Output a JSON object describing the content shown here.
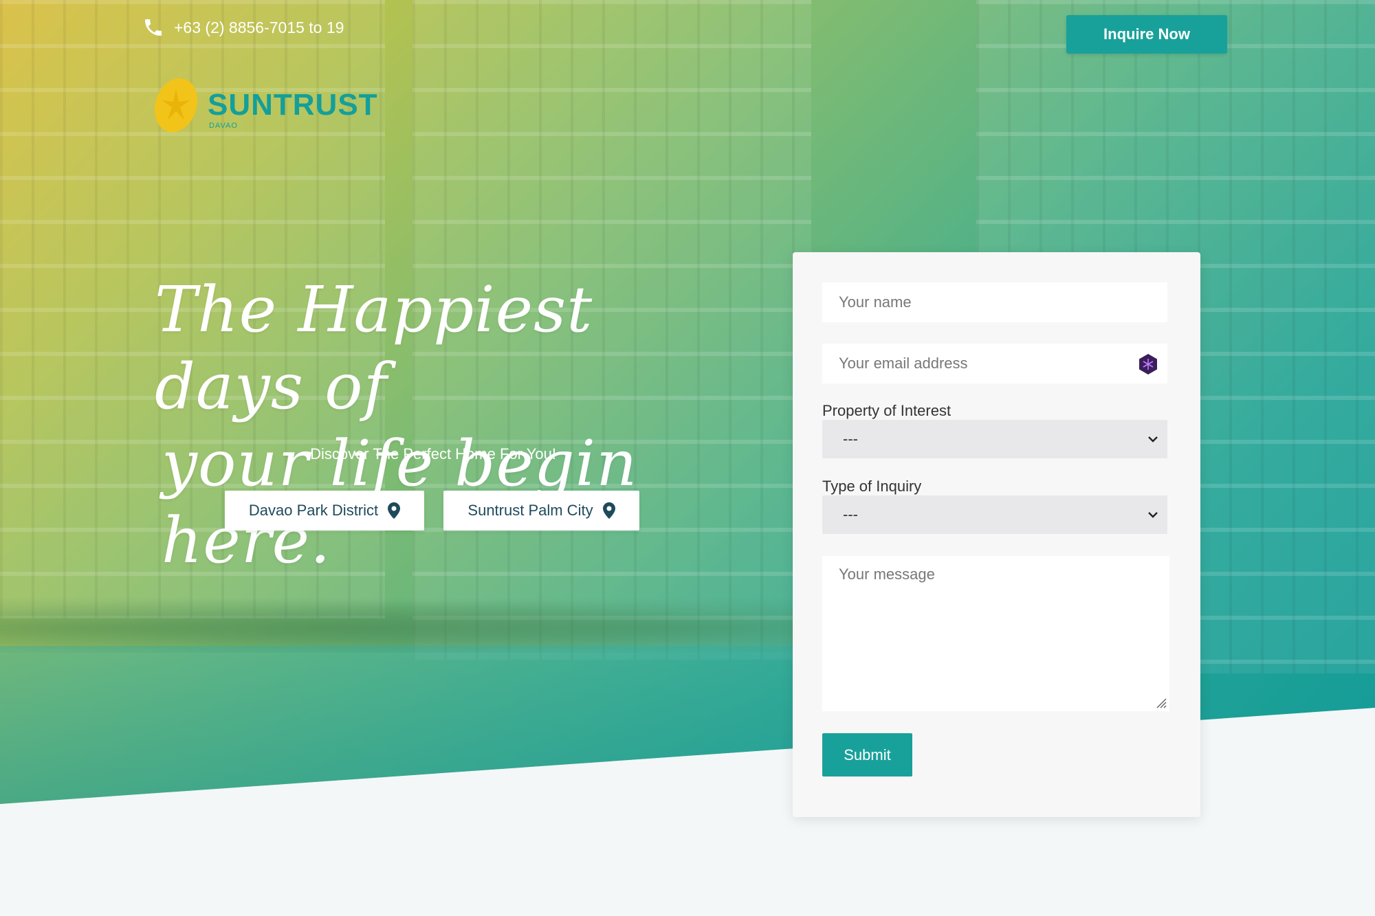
{
  "header": {
    "phone": "+63 (2) 8856-7015 to 19",
    "inquire_label": "Inquire Now"
  },
  "logo": {
    "name": "SUNTRUST",
    "sub": "DAVAO"
  },
  "hero": {
    "headline_line1": "The Happiest days of",
    "headline_line2": "your life begin here.",
    "tagline": "Discover The Perfect Home For You!",
    "locations": [
      {
        "label": "Davao Park District",
        "icon": "map-pin-icon"
      },
      {
        "label": "Suntrust Palm City",
        "icon": "map-pin-icon"
      }
    ]
  },
  "form": {
    "name_placeholder": "Your name",
    "email_placeholder": "Your email address",
    "property_label": "Property of Interest",
    "property_value": "---",
    "inquiry_label": "Type of Inquiry",
    "inquiry_value": "---",
    "message_placeholder": "Your message",
    "submit_label": "Submit"
  },
  "colors": {
    "accent": "#18a19a",
    "logo_yellow": "#f2c318",
    "pin": "#1f4a5c"
  }
}
